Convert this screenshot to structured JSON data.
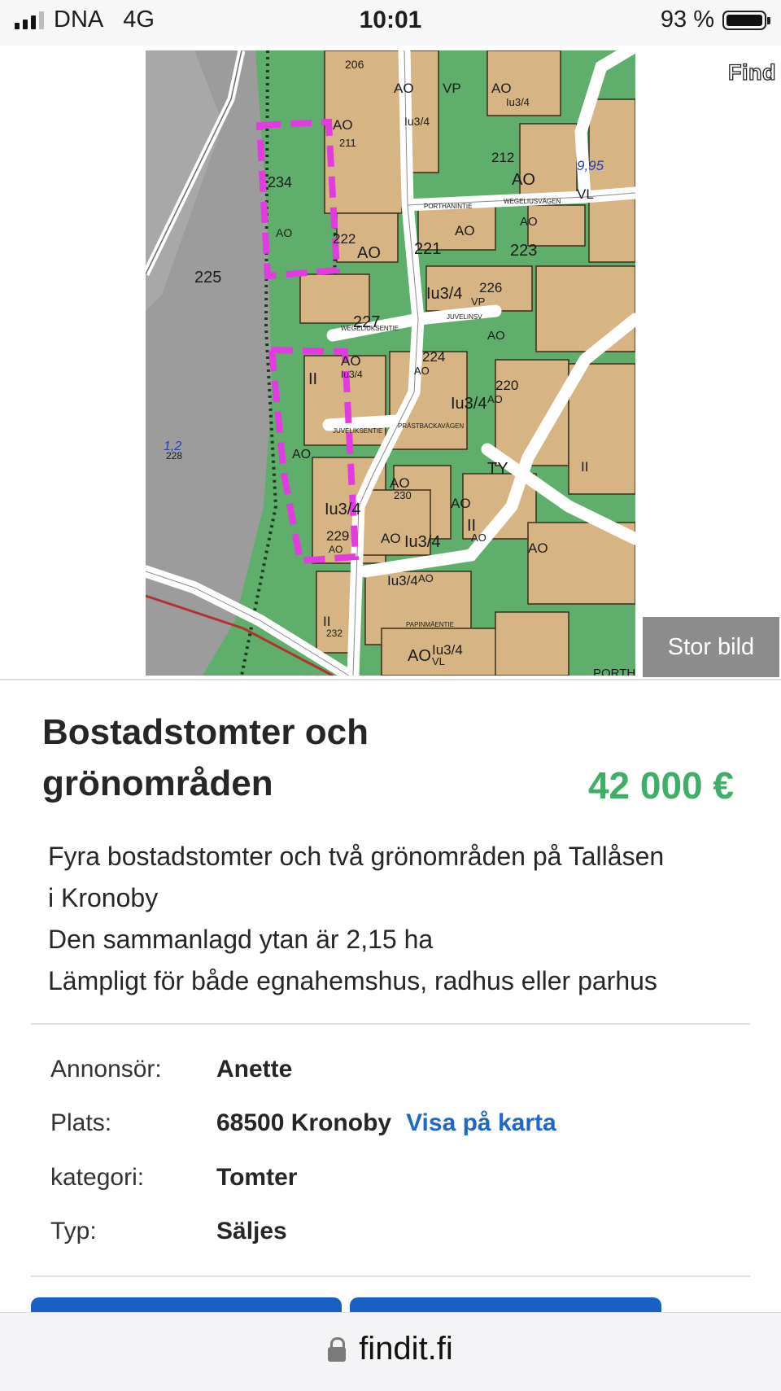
{
  "status_bar": {
    "carrier": "DNA",
    "network": "4G",
    "time": "10:01",
    "battery": "93 %",
    "battery_level": 0.93
  },
  "gallery": {
    "watermark": "Find",
    "large_image_button": "Stor bild",
    "map_labels": [
      "206",
      "AO",
      "VP",
      "Iu3/4",
      "AO",
      "Iu3/4",
      "AO",
      "211",
      "212",
      "AO",
      "9,95",
      "VL",
      "234",
      "AO",
      "225",
      "222",
      "AO",
      "221",
      "AO",
      "223",
      "AO",
      "Iu3/4",
      "226",
      "VP",
      "227",
      "AO",
      "II",
      "AO",
      "Iu3/4",
      "224",
      "AO",
      "Iu3/4",
      "220",
      "AO",
      "TY",
      "II",
      "1,2",
      "228",
      "AO",
      "Iu3/4",
      "AO",
      "230",
      "AO",
      "II",
      "AO",
      "229",
      "AO",
      "AO",
      "Iu3/4",
      "AO",
      "Iu3/4",
      "AO",
      "II",
      "232",
      "AO",
      "Iu3/4",
      "VL",
      "PORTHANSVÄGEN",
      "PORTHANINTIE",
      "WEGELIUSVÄGEN",
      "WEGELIUKSENTIE",
      "JUVELINSV",
      "JUVELIKSENTIE",
      "PRÄSTBACKAVÄGEN",
      "PAPINMÄENTIE"
    ]
  },
  "listing": {
    "title_line1": "Bostadstomter och",
    "title_line2": "grönområden",
    "price": "42 000 €",
    "description": [
      "Fyra bostadstomter och två grönområden på Tallåsen",
      "i Kronoby",
      "Den sammanlagd ytan är 2,15 ha",
      "Lämpligt för både egnahemshus, radhus eller parhus"
    ],
    "details": {
      "advertiser_label": "Annonsör:",
      "advertiser_value": "Anette",
      "location_label": "Plats:",
      "location_value": "68500 Kronoby",
      "map_link": "Visa på karta",
      "category_label": "kategori:",
      "category_value": "Tomter",
      "type_label": "Typ:",
      "type_value": "Säljes"
    }
  },
  "browser": {
    "url": "findit.fi"
  },
  "colors": {
    "price": "#3fae66",
    "link": "#1d68c9",
    "button": "#1a5fc3",
    "map_green": "#5fae6c",
    "map_plot": "#d6b483",
    "map_gray": "#9c9c9c",
    "boundary_magenta": "#e23ce0"
  }
}
